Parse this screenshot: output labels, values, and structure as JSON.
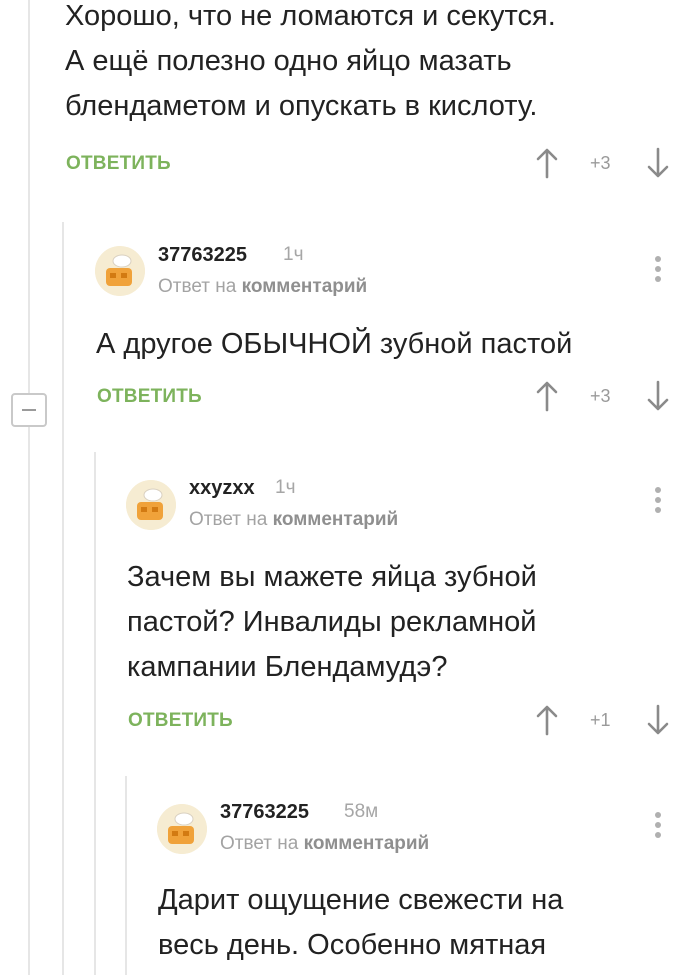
{
  "comments": [
    {
      "text_lines": [
        "Хорошо, что не ломаются и секутся.",
        "А ещё полезно одно яйцо мазать",
        "блендаметом и опускать в кислоту."
      ],
      "reply_label": "ОТВЕТИТЬ",
      "score": "+3"
    },
    {
      "author": "37763225",
      "time": "1ч",
      "reply_prefix": "Ответ на",
      "reply_target": "комментарий",
      "text_lines": [
        "А другое ОБЫЧНОЙ зубной пастой"
      ],
      "reply_label": "ОТВЕТИТЬ",
      "score": "+3"
    },
    {
      "author": "xxyzxx",
      "time": "1ч",
      "reply_prefix": "Ответ на",
      "reply_target": "комментарий",
      "text_lines": [
        "Зачем вы мажете яйца зубной",
        "пастой? Инвалиды рекламной",
        "кампании Блендамудэ?"
      ],
      "reply_label": "ОТВЕТИТЬ",
      "score": "+1"
    },
    {
      "author": "37763225",
      "time": "58м",
      "reply_prefix": "Ответ на",
      "reply_target": "комментарий",
      "text_lines": [
        "Дарит ощущение свежести на",
        "весь день. Особенно мятная"
      ]
    }
  ],
  "colors": {
    "accent_green": "#7db35c",
    "thread_line": "#e6e6e6",
    "muted_text": "#a6a6a6"
  },
  "icons": [
    "arrow-up-icon",
    "arrow-down-icon",
    "more-vertical-icon",
    "collapse-minus-icon",
    "chef-avatar-icon"
  ]
}
